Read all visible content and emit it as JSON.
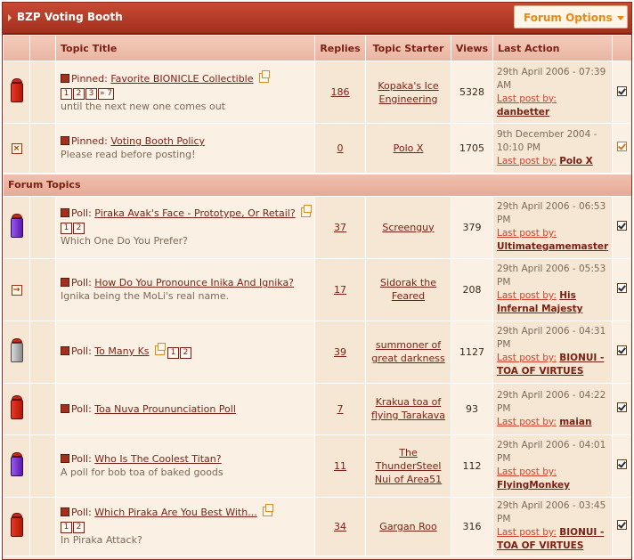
{
  "forum": {
    "title": "BZP Voting Booth",
    "options_label": "Forum Options"
  },
  "columns": {
    "topic_title": "Topic Title",
    "replies": "Replies",
    "topic_starter": "Topic Starter",
    "views": "Views",
    "last_action": "Last Action"
  },
  "section_label": "Forum Topics",
  "last_post_label": "Last post by:",
  "pinned_topics": [
    {
      "icon": "red-bin-icon",
      "prefix": "Pinned:",
      "title": "Favorite BIONICLE Collectible",
      "pages": [
        "1",
        "2",
        "3",
        "» 7"
      ],
      "description": "until the next new one comes out",
      "replies": "186",
      "starter": "Kopaka's Ice Engineering",
      "views": "5328",
      "date": "29th April 2006 - 07:39 AM",
      "last_by": "danbetter"
    },
    {
      "icon": "closed-topic-icon",
      "prefix": "Pinned:",
      "title": "Voting Booth Policy",
      "pages": [],
      "description": "Please read before posting!",
      "replies": "0",
      "starter": "Polo X",
      "views": "1705",
      "date": "9th December 2004 - 10:10 PM",
      "last_by": "Polo X"
    }
  ],
  "topics": [
    {
      "icon": "purple-bin-icon",
      "prefix": "Poll:",
      "title": "Piraka Avak's Face - Prototype, Or Retail?",
      "pages": [
        "1",
        "2"
      ],
      "description": "Which One Do You Prefer?",
      "replies": "37",
      "starter": "Screenguy",
      "views": "379",
      "date": "29th April 2006 - 06:53 PM",
      "last_by": "Ultimategamemaster"
    },
    {
      "icon": "moved-topic-icon",
      "prefix": "Poll:",
      "title": "How Do You Pronounce Inika And Ignika?",
      "pages": [],
      "description": "Ignika being the MoLi's real name.",
      "replies": "17",
      "starter": "Sidorak the Feared",
      "views": "208",
      "date": "29th April 2006 - 05:53 PM",
      "last_by": "His Infernal Majesty"
    },
    {
      "icon": "grey-bin-icon",
      "prefix": "Poll:",
      "title": "To Many Ks",
      "pages": [
        "1",
        "2"
      ],
      "description": "",
      "replies": "39",
      "starter": "summoner of great darkness",
      "views": "1127",
      "date": "29th April 2006 - 04:31 PM",
      "last_by": "BIONUI - TOA OF VIRTUES"
    },
    {
      "icon": "red-bin-icon",
      "prefix": "Poll:",
      "title": "Toa Nuva Prounun­ciation Poll",
      "pages": [],
      "description": "",
      "replies": "7",
      "starter": "Krakua toa of flying Tarakava",
      "views": "93",
      "date": "29th April 2006 - 04:22 PM",
      "last_by": "maian"
    },
    {
      "icon": "purple-bin-icon",
      "prefix": "Poll:",
      "title": "Who Is The Coolest Titan?",
      "pages": [],
      "description": "A poll for bob toa of baked goods",
      "replies": "11",
      "starter": "The ThunderSteel Nui of Area51",
      "views": "112",
      "date": "29th April 2006 - 04:01 PM",
      "last_by": "FlyingMonkey"
    },
    {
      "icon": "red-bin-icon",
      "prefix": "Poll:",
      "title": "Which Piraka Are You Best With...",
      "pages": [
        "1",
        "2"
      ],
      "description": "In Piraka Attack?",
      "replies": "34",
      "starter": "Gargan Roo",
      "views": "316",
      "date": "29th April 2006 - 03:45 PM",
      "last_by": "BIONUI - TOA OF VIRTUES"
    }
  ]
}
